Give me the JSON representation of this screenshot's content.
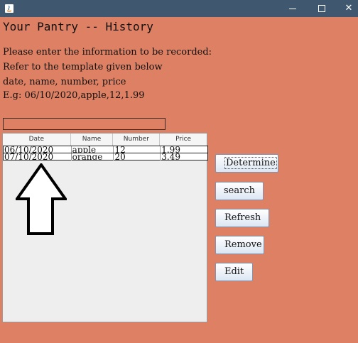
{
  "titlebar": {
    "minimize_icon": "minimize-icon",
    "maximize_icon": "maximize-icon",
    "close_glyph": "✕"
  },
  "heading": "Your Pantry -- History",
  "instructions": [
    "Please enter the information to be recorded:",
    "Refer to the template given below",
    "date, name, number, price",
    "E.g: 06/10/2020,apple,12,1.99"
  ],
  "input": {
    "value": "",
    "placeholder": ""
  },
  "table": {
    "columns": [
      "Date",
      "Name",
      "Number",
      "Price"
    ],
    "rows": [
      [
        "06/10/2020",
        "apple",
        "12",
        "1.99"
      ],
      [
        "07/10/2020",
        "orange",
        "20",
        "3.49"
      ]
    ]
  },
  "buttons": {
    "determine": "Determine",
    "search": "search",
    "refresh": "Refresh",
    "remove": "Remove",
    "edit": "Edit"
  },
  "colors": {
    "background": "#dd8063",
    "titlebar": "#3f5870"
  }
}
